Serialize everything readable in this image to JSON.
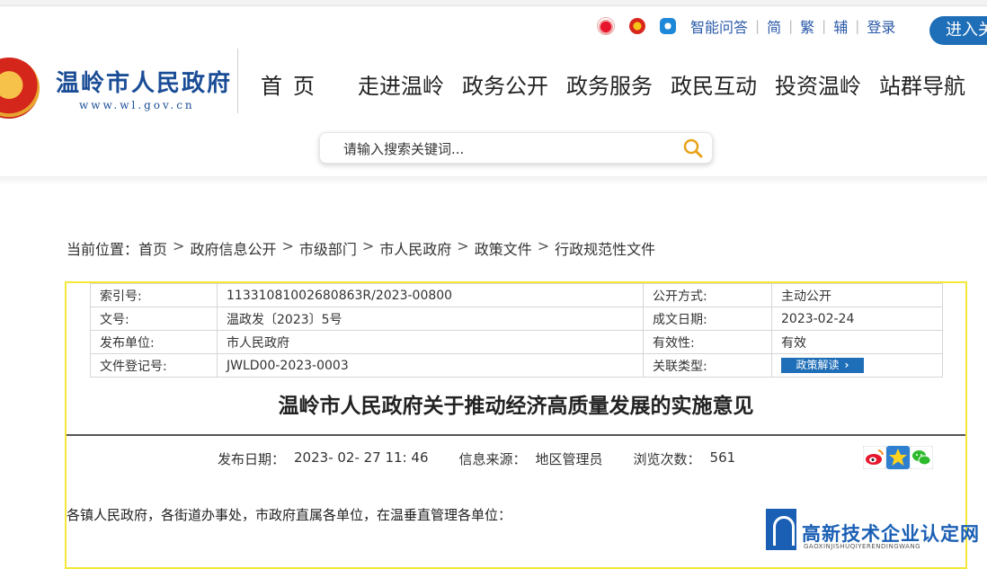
{
  "util": {
    "icons": [
      "weibo-icon",
      "party-icon",
      "app-icon"
    ],
    "links": [
      "智能问答",
      "简",
      "繁",
      "辅",
      "登录"
    ],
    "enter_label": "进入关"
  },
  "logo": {
    "title": "温岭市人民政府",
    "url": "www.wl.gov.cn"
  },
  "nav": [
    "首页",
    "走进温岭",
    "政务公开",
    "政务服务",
    "政民互动",
    "投资温岭",
    "站群导航"
  ],
  "search": {
    "placeholder": "请输入搜索关键词..."
  },
  "breadcrumb": {
    "prefix": "当前位置：",
    "items": [
      "首页",
      "政府信息公开",
      "市级部门",
      "市人民政府",
      "政策文件",
      "行政规范性文件"
    ],
    "separator": ">"
  },
  "meta": {
    "rows": [
      {
        "k1": "索引号:",
        "v1": "11331081002680863R/2023-00800",
        "k2": "公开方式:",
        "v2": "主动公开"
      },
      {
        "k1": "文号:",
        "v1": "温政发〔2023〕5号",
        "k2": "成文日期:",
        "v2": "2023-02-24"
      },
      {
        "k1": "发布单位:",
        "v1": "市人民政府",
        "k2": "有效性:",
        "v2": "有效"
      },
      {
        "k1": "文件登记号:",
        "v1": "JWLD00-2023-0003",
        "k2": "关联类型:",
        "v2": ""
      }
    ],
    "policy_button": "政策解读"
  },
  "article": {
    "title": "温岭市人民政府关于推动经济高质量发展的实施意见",
    "publish_label": "发布日期：",
    "publish_date": "2023- 02- 27 11: 46",
    "source_label": "信息来源：",
    "source": "地区管理员",
    "views_label": "浏览次数：",
    "views": "561",
    "share_icons": [
      "weibo-share-icon",
      "star-share-icon",
      "wechat-share-icon"
    ],
    "first_line": "各镇人民政府，各街道办事处，市政府直属各单位，在温垂直管理各单位："
  },
  "watermark": {
    "text": "高新技术企业认定网",
    "sub": "GAOXINJISHUQIYERENDINGWANG"
  },
  "colors": {
    "brand_blue": "#1a4d96",
    "button_blue": "#1f6fb8",
    "frame_yellow": "#f3e73a"
  }
}
